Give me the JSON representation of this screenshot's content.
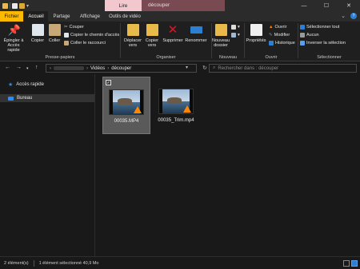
{
  "window": {
    "context_tab": "Lire",
    "title": "découper",
    "controls": {
      "minimize": "—",
      "maximize": "☐",
      "close": "✕"
    }
  },
  "tabs": [
    {
      "label": "Fichier"
    },
    {
      "label": "Accueil"
    },
    {
      "label": "Partage"
    },
    {
      "label": "Affichage"
    },
    {
      "label": "Outils de vidéo"
    }
  ],
  "ribbon": {
    "presse_papiers": {
      "label": "Presse-papiers",
      "epingler": "Épingler à Accès rapide",
      "copier": "Copier",
      "coller": "Coller",
      "couper": "Couper",
      "copier_chemin": "Copier le chemin d'accès",
      "coller_raccourci": "Coller le raccourci"
    },
    "organiser": {
      "label": "Organiser",
      "deplacer": "Déplacer vers",
      "copier_vers": "Copier vers",
      "supprimer": "Supprimer",
      "renommer": "Renommer"
    },
    "nouveau": {
      "label": "Nouveau",
      "nouveau_dossier": "Nouveau dossier"
    },
    "ouvrir": {
      "label": "Ouvrir",
      "proprietes": "Propriétés",
      "ouvrir": "Ouvrir",
      "modifier": "Modifier",
      "historique": "Historique"
    },
    "selectionner": {
      "label": "Sélectionner",
      "tout": "Sélectionner tout",
      "aucun": "Aucun",
      "inverser": "Inverser la sélection"
    }
  },
  "address": {
    "segments": [
      "Vidéos",
      "découper"
    ],
    "search_placeholder": "Rechercher dans : découper"
  },
  "nav": {
    "quick_access": "Accès rapide",
    "bureau": "Bureau"
  },
  "files": [
    {
      "name": "00035.MP4",
      "selected": true
    },
    {
      "name": "00035_Trim.mp4",
      "selected": false
    }
  ],
  "status": {
    "count": "2 élément(s)",
    "selection": "1 élément sélectionné  40,9 Mo"
  },
  "colors": {
    "accent": "#2d7fd3",
    "fichier_tab": "#ffb900",
    "lire_tab": "#f3c7ce"
  }
}
